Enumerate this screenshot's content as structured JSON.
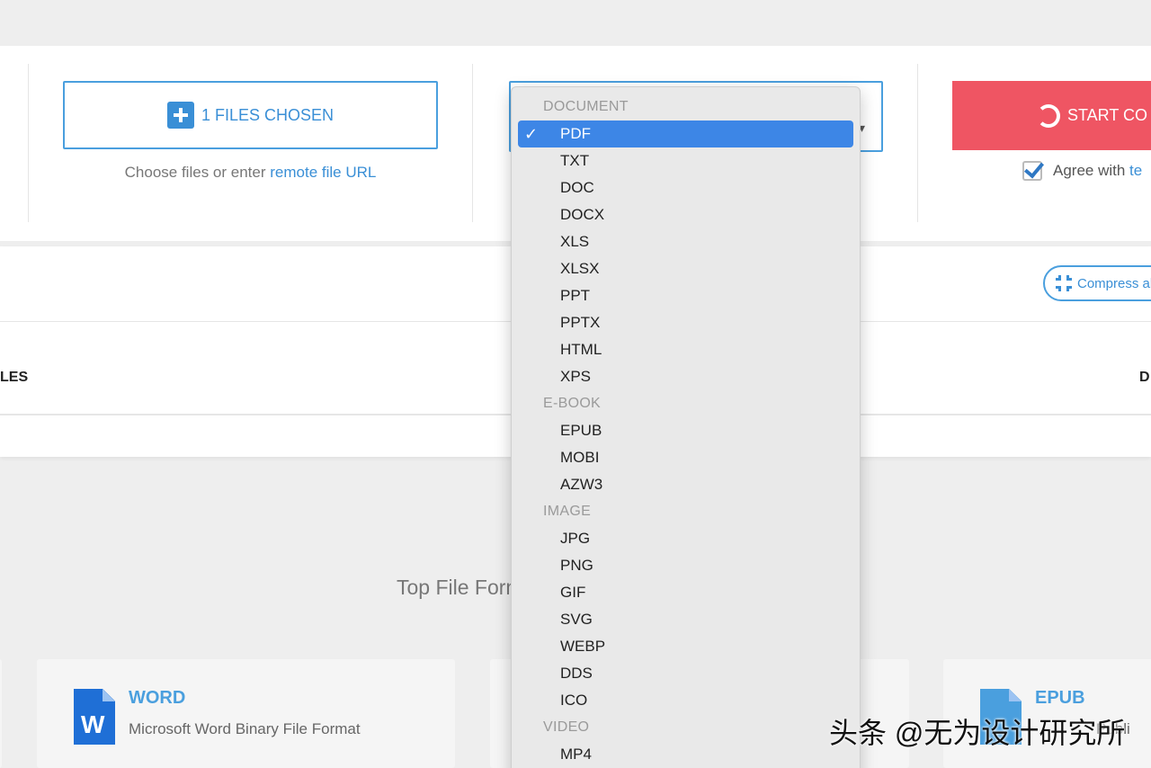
{
  "upload": {
    "choose_button": "1 FILES CHOSEN",
    "hint_prefix": "Choose files or enter ",
    "hint_link": "remote file URL",
    "start_button": "START CO",
    "agree_prefix": "Agree with ",
    "agree_link": "te",
    "agree_checked": true
  },
  "files_panel": {
    "compress_button": "Compress al",
    "col_files": "LES",
    "col_right": "D"
  },
  "top_formats_heading": "Top File Form",
  "cards": [
    {
      "title": "WORD",
      "desc": "Microsoft Word Binary File Format",
      "icon": "word-doc-icon",
      "glyph": "W"
    },
    {
      "title": "EPUB",
      "desc": "Publi",
      "icon": "epub-doc-icon",
      "glyph": ""
    }
  ],
  "dropdown": {
    "selected": "PDF",
    "groups": [
      {
        "label": "DOCUMENT",
        "items": [
          "PDF",
          "TXT",
          "DOC",
          "DOCX",
          "XLS",
          "XLSX",
          "PPT",
          "PPTX",
          "HTML",
          "XPS"
        ]
      },
      {
        "label": "E-BOOK",
        "items": [
          "EPUB",
          "MOBI",
          "AZW3"
        ]
      },
      {
        "label": "IMAGE",
        "items": [
          "JPG",
          "PNG",
          "GIF",
          "SVG",
          "WEBP",
          "DDS",
          "ICO"
        ]
      },
      {
        "label": "VIDEO",
        "items": [
          "MP4"
        ]
      }
    ]
  },
  "watermark": "头条 @无为设计研究所",
  "colors": {
    "accent": "#3a8fd6",
    "start_button": "#ef5563",
    "selected_item": "#3d86e6"
  }
}
